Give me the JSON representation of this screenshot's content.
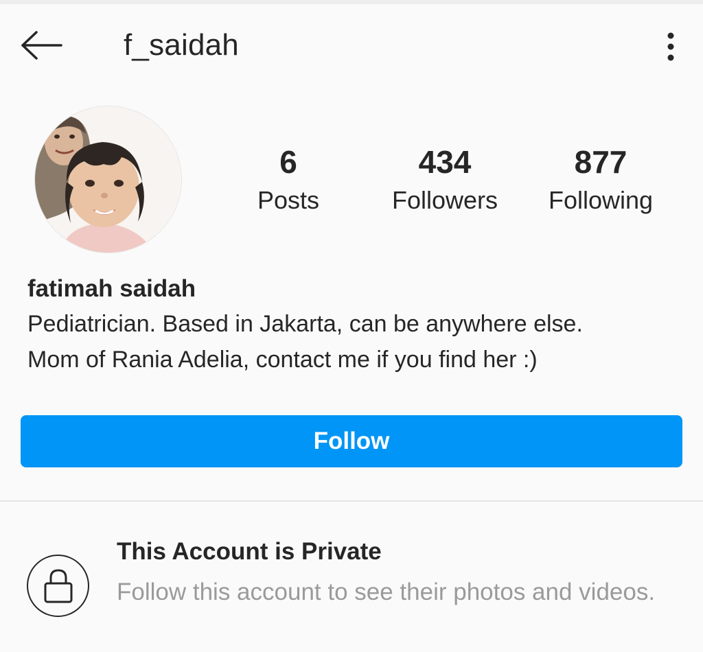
{
  "header": {
    "username": "f_saidah",
    "back_icon": "arrow-left-icon",
    "menu_icon": "more-vertical-icon"
  },
  "profile": {
    "avatar": "profile-photo",
    "stats": {
      "posts": {
        "count": "6",
        "label": "Posts"
      },
      "followers": {
        "count": "434",
        "label": "Followers"
      },
      "following": {
        "count": "877",
        "label": "Following"
      }
    },
    "full_name": "fatimah saidah",
    "bio": [
      "Pediatrician. Based in Jakarta, can be anywhere else.",
      "Mom of Rania Adelia, contact me if you find her :)"
    ]
  },
  "actions": {
    "follow_label": "Follow"
  },
  "private_notice": {
    "icon": "lock-icon",
    "title": "This Account is Private",
    "description": "Follow this account to see their photos and videos."
  },
  "colors": {
    "accent": "#0095f6",
    "background": "#fafafa",
    "text": "#262626",
    "muted": "#9a9a9a"
  }
}
